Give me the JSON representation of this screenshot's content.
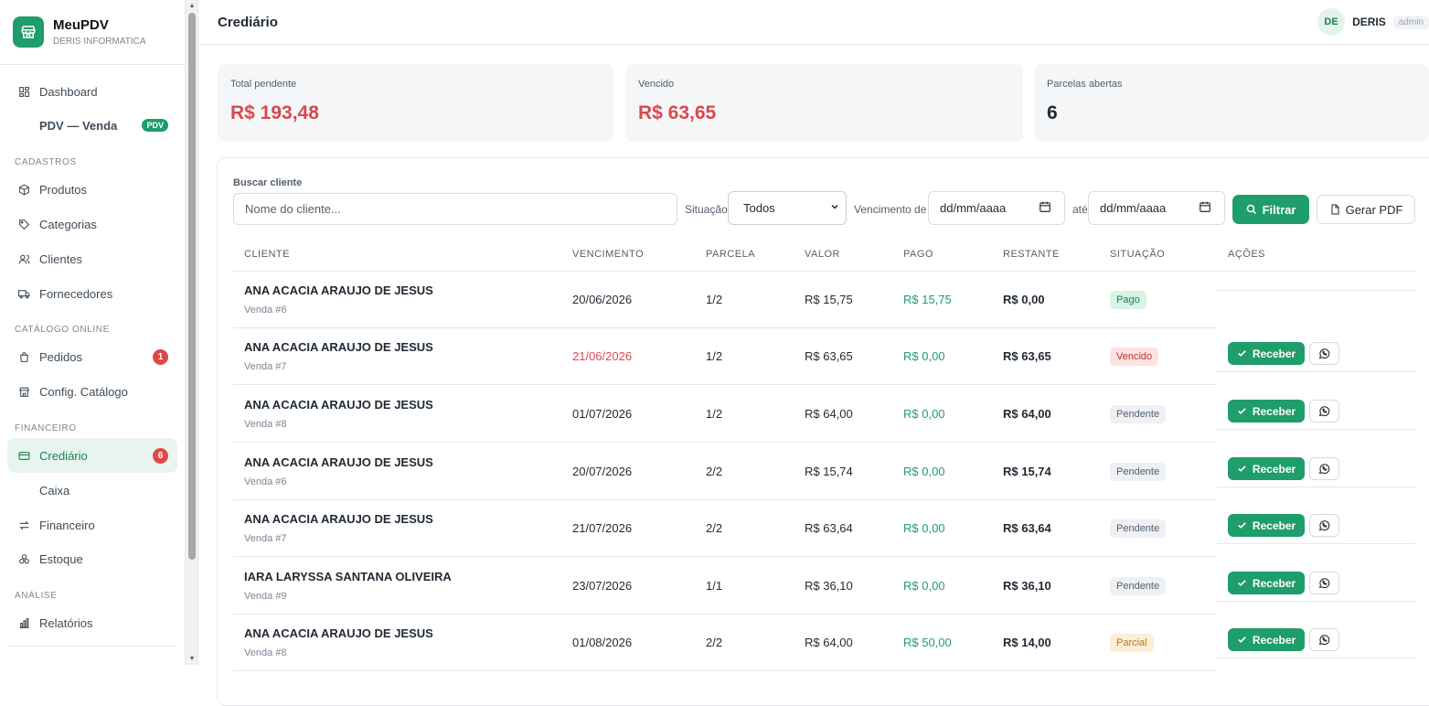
{
  "brand": {
    "name": "MeuPDV",
    "subtitle": "DERIS INFORMATICA"
  },
  "sidebar": {
    "items": [
      {
        "label": "Dashboard",
        "icon": "grid-icon"
      },
      {
        "label": "PDV — Venda",
        "tag": "PDV"
      },
      {
        "label": "Produtos",
        "icon": "box-icon"
      },
      {
        "label": "Categorias",
        "icon": "tag-icon"
      },
      {
        "label": "Clientes",
        "icon": "users-icon"
      },
      {
        "label": "Fornecedores",
        "icon": "truck-icon"
      },
      {
        "label": "Pedidos",
        "icon": "bag-icon",
        "badge": "1"
      },
      {
        "label": "Config. Catálogo",
        "icon": "store-icon"
      },
      {
        "label": "Crediário",
        "icon": "card-icon",
        "badge": "6",
        "active": true
      },
      {
        "label": "Caixa"
      },
      {
        "label": "Financeiro",
        "icon": "arrows-icon"
      },
      {
        "label": "Estoque",
        "icon": "boxes-icon"
      },
      {
        "label": "Relatórios",
        "icon": "chart-icon"
      }
    ],
    "sections": [
      "CADASTROS",
      "CATÁLOGO ONLINE",
      "FINANCEIRO",
      "ANÁLISE"
    ]
  },
  "header": {
    "title": "Crediário",
    "user_initials": "DE",
    "user_name": "DERIS",
    "user_role": "admin"
  },
  "summary": [
    {
      "label": "Total pendente",
      "value": "R$ 193,48",
      "color": "#d9484f"
    },
    {
      "label": "Vencido",
      "value": "R$ 63,65",
      "color": "#d9484f"
    },
    {
      "label": "Parcelas abertas",
      "value": "6",
      "color": "#1f2933"
    }
  ],
  "filters": {
    "search_label": "Buscar cliente",
    "search_placeholder": "Nome do cliente...",
    "status_label": "Situação",
    "status_value": "Todos",
    "due_label": "Vencimento de",
    "date_from_placeholder": "dd/mm/aaaa",
    "until_label": "até",
    "date_to_placeholder": "dd/mm/aaaa",
    "filter_button": "Filtrar",
    "pdf_button": "Gerar PDF"
  },
  "table": {
    "columns": [
      "CLIENTE",
      "VENCIMENTO",
      "PARCELA",
      "VALOR",
      "PAGO",
      "RESTANTE",
      "SITUAÇÃO",
      "AÇÕES"
    ],
    "receive_label": "Receber",
    "rows": [
      {
        "client": "ANA ACACIA ARAUJO DE JESUS",
        "sale": "Venda #6",
        "due": "20/06/2026",
        "installment": "1/2",
        "value": "R$ 15,75",
        "paid": "R$ 15,75",
        "remaining": "R$ 0,00",
        "status": "Pago",
        "overdue": false,
        "actions": false
      },
      {
        "client": "ANA ACACIA ARAUJO DE JESUS",
        "sale": "Venda #7",
        "due": "21/06/2026",
        "installment": "1/2",
        "value": "R$ 63,65",
        "paid": "R$ 0,00",
        "remaining": "R$ 63,65",
        "status": "Vencido",
        "overdue": true,
        "actions": true
      },
      {
        "client": "ANA ACACIA ARAUJO DE JESUS",
        "sale": "Venda #8",
        "due": "01/07/2026",
        "installment": "1/2",
        "value": "R$ 64,00",
        "paid": "R$ 0,00",
        "remaining": "R$ 64,00",
        "status": "Pendente",
        "overdue": false,
        "actions": true
      },
      {
        "client": "ANA ACACIA ARAUJO DE JESUS",
        "sale": "Venda #6",
        "due": "20/07/2026",
        "installment": "2/2",
        "value": "R$ 15,74",
        "paid": "R$ 0,00",
        "remaining": "R$ 15,74",
        "status": "Pendente",
        "overdue": false,
        "actions": true
      },
      {
        "client": "ANA ACACIA ARAUJO DE JESUS",
        "sale": "Venda #7",
        "due": "21/07/2026",
        "installment": "2/2",
        "value": "R$ 63,64",
        "paid": "R$ 0,00",
        "remaining": "R$ 63,64",
        "status": "Pendente",
        "overdue": false,
        "actions": true
      },
      {
        "client": "IARA LARYSSA SANTANA OLIVEIRA",
        "sale": "Venda #9",
        "due": "23/07/2026",
        "installment": "1/1",
        "value": "R$ 36,10",
        "paid": "R$ 0,00",
        "remaining": "R$ 36,10",
        "status": "Pendente",
        "overdue": false,
        "actions": true
      },
      {
        "client": "ANA ACACIA ARAUJO DE JESUS",
        "sale": "Venda #8",
        "due": "01/08/2026",
        "installment": "2/2",
        "value": "R$ 64,00",
        "paid": "R$ 50,00",
        "remaining": "R$ 14,00",
        "status": "Parcial",
        "overdue": false,
        "actions": true
      }
    ]
  }
}
